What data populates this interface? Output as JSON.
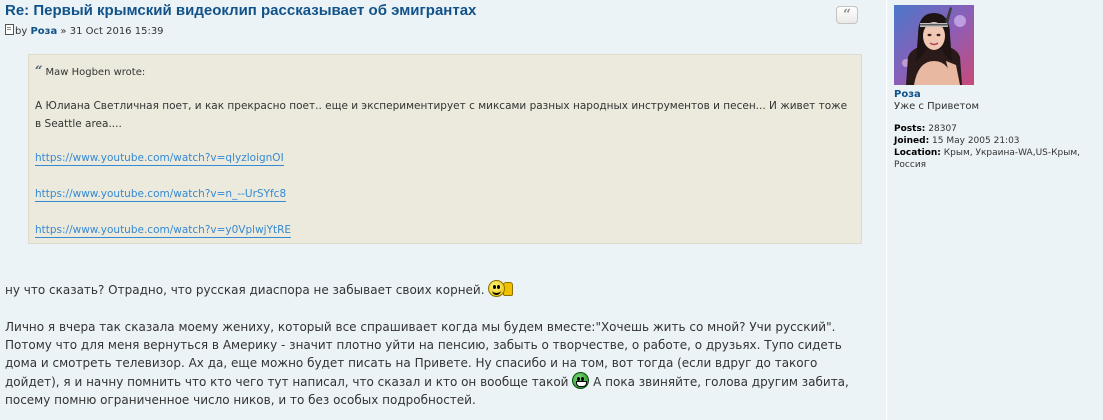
{
  "post": {
    "title": "Re: Первый крымский видеоклип рассказывает об эмигрантах",
    "by_label": "by",
    "author": "Роза",
    "separator": "»",
    "date": "31 Oct 2016 15:39",
    "quote_button_label": "“"
  },
  "quote": {
    "cite_mark": "“",
    "cite": "Maw Hogben wrote:",
    "text": "А Юлиана Светличная поет, и как прекрасно поет.. еще и экспериментирует с миксами разных народных инструментов и песен... И живет тоже в Seattle area....",
    "links": [
      "https://www.youtube.com/watch?v=qlyzloignOI",
      "https://www.youtube.com/watch?v=n_--UrSYfc8",
      "https://www.youtube.com/watch?v=y0VplwjYtRE"
    ]
  },
  "content": {
    "paragraph1": "ну что сказать? Отрадно, что русская диаспора не забывает своих корней.",
    "paragraph2_a": "Лично я вчера так сказала моему жениху, который все спрашивает когда мы будем вместе:\"Хочешь жить со мной? Учи русский\". Потому что для меня вернуться в Америку - значит плотно уйти на пенсию, забыть о творчестве, о работе, о друзьях. Тупо сидеть дома и смотреть телевизор. Ах да, еще можно будет писать на Привете. Ну спасибо и на том, вот тогда (если вдруг до такого дойдет), я и начну помнить что кто чего тут написал, что сказал и кто он вообще такой",
    "paragraph2_b": " А пока звиняйте, голова другим забита, посему помню ограниченное число ников, и то без особых подробностей."
  },
  "profile": {
    "name": "Роза",
    "rank": "Уже с Приветом",
    "posts_label": "Posts:",
    "posts": "28307",
    "joined_label": "Joined:",
    "joined": "15 May 2005 21:03",
    "location_label": "Location:",
    "location": "Крым, Украина-WA,US-Крым, Россия"
  },
  "colors": {
    "background": "#ecf3f7",
    "title": "#105289",
    "link": "#368ad2",
    "quote_bg": "#ebeadd"
  }
}
